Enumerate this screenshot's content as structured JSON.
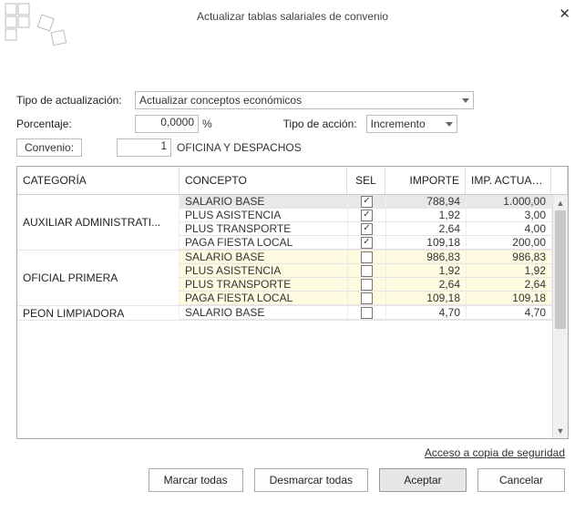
{
  "title": "Actualizar tablas salariales de convenio",
  "form": {
    "tipo_label": "Tipo de actualización:",
    "tipo_value": "Actualizar conceptos económicos",
    "porcentaje_label": "Porcentaje:",
    "porcentaje_value": "0,0000",
    "porcentaje_unit": "%",
    "tipo_accion_label": "Tipo de acción:",
    "tipo_accion_value": "Incremento",
    "convenio_btn": "Convenio:",
    "convenio_num": "1",
    "convenio_name": "OFICINA Y DESPACHOS"
  },
  "columns": {
    "categoria": "CATEGORÍA",
    "concepto": "CONCEPTO",
    "sel": "SEL",
    "importe": "IMPORTE",
    "imp_actual": "IMP. ACTUALI..."
  },
  "groups": [
    {
      "categoria": "AUXILIAR ADMINISTRATI...",
      "rows": [
        {
          "concepto": "SALARIO BASE",
          "sel": true,
          "importe": "788,94",
          "imp_act": "1.000,00",
          "hl": "sel"
        },
        {
          "concepto": "PLUS ASISTENCIA",
          "sel": true,
          "importe": "1,92",
          "imp_act": "3,00",
          "hl": ""
        },
        {
          "concepto": "PLUS TRANSPORTE",
          "sel": true,
          "importe": "2,64",
          "imp_act": "4,00",
          "hl": ""
        },
        {
          "concepto": "PAGA FIESTA LOCAL",
          "sel": true,
          "importe": "109,18",
          "imp_act": "200,00",
          "hl": ""
        }
      ]
    },
    {
      "categoria": "OFICIAL PRIMERA",
      "rows": [
        {
          "concepto": "SALARIO BASE",
          "sel": false,
          "importe": "986,83",
          "imp_act": "986,83",
          "hl": "yellow"
        },
        {
          "concepto": "PLUS ASISTENCIA",
          "sel": false,
          "importe": "1,92",
          "imp_act": "1,92",
          "hl": "yellow"
        },
        {
          "concepto": "PLUS TRANSPORTE",
          "sel": false,
          "importe": "2,64",
          "imp_act": "2,64",
          "hl": "yellow"
        },
        {
          "concepto": "PAGA FIESTA LOCAL",
          "sel": false,
          "importe": "109,18",
          "imp_act": "109,18",
          "hl": "yellow"
        }
      ]
    },
    {
      "categoria": "PEON LIMPIADORA",
      "rows": [
        {
          "concepto": "SALARIO BASE",
          "sel": false,
          "importe": "4,70",
          "imp_act": "4,70",
          "hl": ""
        }
      ]
    }
  ],
  "footer_link": "Acceso a copia de seguridad",
  "buttons": {
    "marcar": "Marcar todas",
    "desmarcar": "Desmarcar todas",
    "aceptar": "Aceptar",
    "cancelar": "Cancelar"
  }
}
